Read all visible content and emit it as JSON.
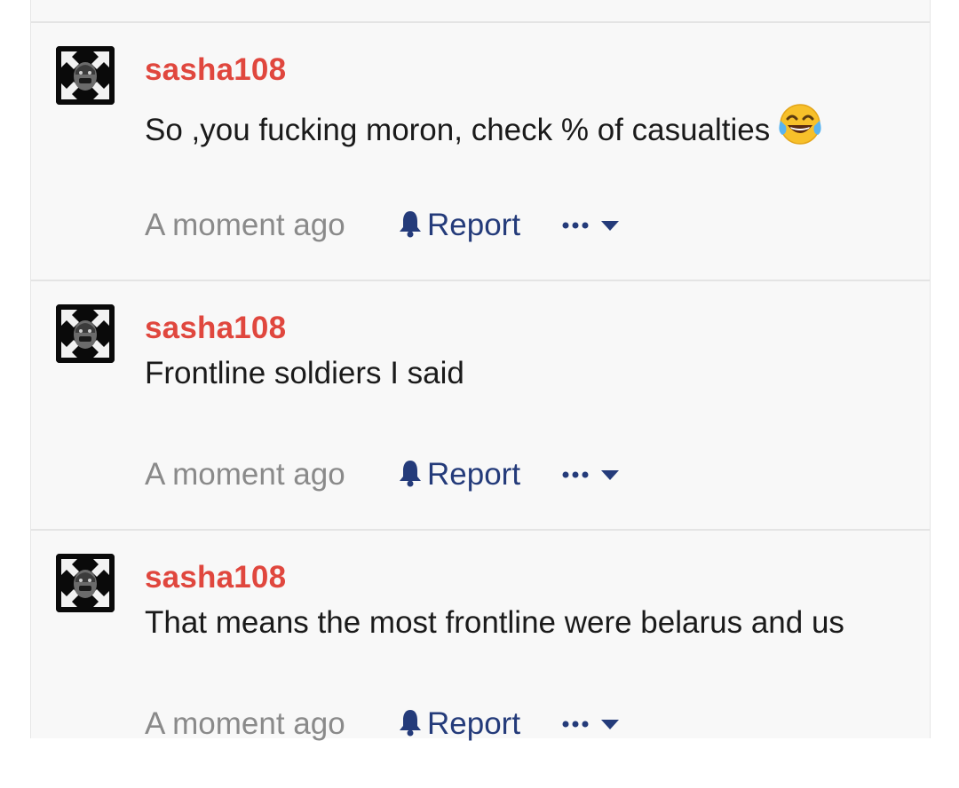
{
  "comments": [
    {
      "username": "sasha108",
      "text": "So ,you fucking moron, check % of casualties",
      "emoji": "tears-of-joy-emoji",
      "time": "A moment ago",
      "report_label": "Report"
    },
    {
      "username": "sasha108",
      "text": "Frontline soldiers I said",
      "time": "A moment ago",
      "report_label": "Report"
    },
    {
      "username": "sasha108",
      "text": "That means the most frontline were belarus and us",
      "time": "A moment ago",
      "report_label": "Report"
    }
  ],
  "icons": {
    "report": "bell-icon",
    "more": "ellipsis-icon",
    "expand": "caret-down-icon"
  },
  "colors": {
    "username": "#e0473e",
    "link": "#243b7a",
    "timestamp": "#8a8a8a",
    "text": "#1a1a1a",
    "background": "#f8f8f8"
  }
}
